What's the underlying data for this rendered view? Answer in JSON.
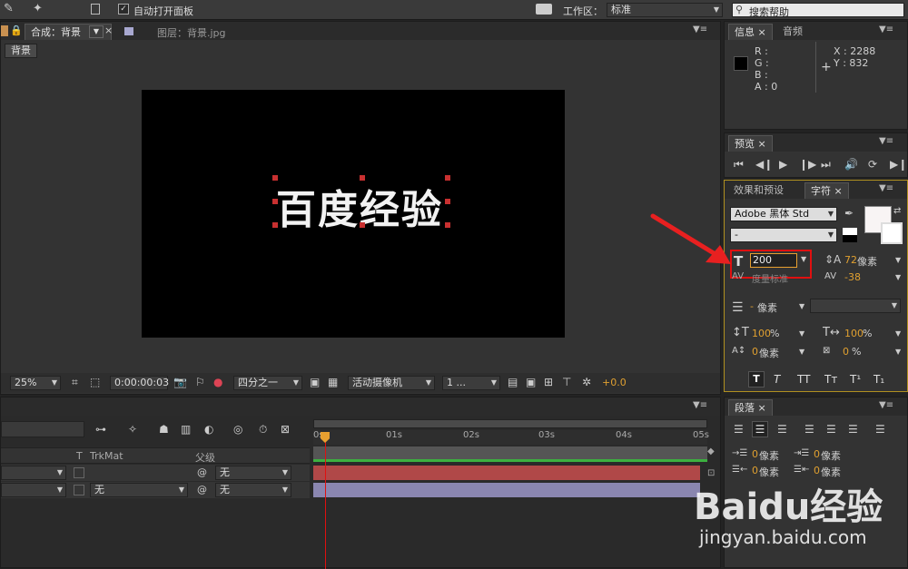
{
  "topbar": {
    "auto_open_label": "自动打开面板",
    "workspace_label": "工作区：",
    "workspace_value": "标准",
    "search_placeholder": "搜索帮助"
  },
  "comp_viewer": {
    "tab_comp": "合成：背景",
    "tab_layer": "图层：背景.jpg",
    "breadcrumb": "背景",
    "canvas_text": "百度经验",
    "zoom": "25%",
    "timecode": "0:00:00:03",
    "resolution": "四分之一",
    "camera": "活动摄像机",
    "views": "1 ...",
    "exposure": "+0.0"
  },
  "info_panel": {
    "tab_info": "信息",
    "tab_audio": "音频",
    "r_label": "R :",
    "g_label": "G :",
    "b_label": "B :",
    "a_label": "A : 0",
    "x_label": "X : 2288",
    "y_label": "Y : 832"
  },
  "preview_panel": {
    "tab": "预览"
  },
  "character_panel": {
    "tab_effects": "效果和预设",
    "tab_char": "字符",
    "font_family": "Adobe 黑体 Std",
    "font_style": "-",
    "font_size": "200",
    "leading_value": "72",
    "leading_unit": "像素",
    "kerning_label": "度量标准",
    "tracking_value": "-38",
    "stroke_unit": "像素",
    "vscale": "100",
    "hscale": "100",
    "percent": "%",
    "baseline_value": "0",
    "baseline_unit": "像素",
    "tsume_value": "0",
    "tsume_unit": "%",
    "style_buttons": [
      "T",
      "T",
      "TT",
      "Tт",
      "T¹",
      "T₁"
    ]
  },
  "timeline": {
    "col_t": "T",
    "col_trkmat": "TrkMat",
    "col_parent": "父级",
    "row1_parent": "无",
    "row2_trkmat": "无",
    "row2_parent": "无",
    "ruler": [
      "0s",
      "01s",
      "02s",
      "03s",
      "04s",
      "05s"
    ]
  },
  "paragraph_panel": {
    "tab": "段落",
    "indent_value": "0",
    "indent_unit": "像素"
  },
  "watermark": {
    "brand": "Baidu经验",
    "url": "jingyan.baidu.com"
  },
  "colors": {
    "accent_orange": "#e8a030",
    "highlight_red": "#e01010",
    "arrow_red": "#e82020",
    "layer_bar_red": "#b04848",
    "layer_bar_purple": "#8a86b0"
  }
}
